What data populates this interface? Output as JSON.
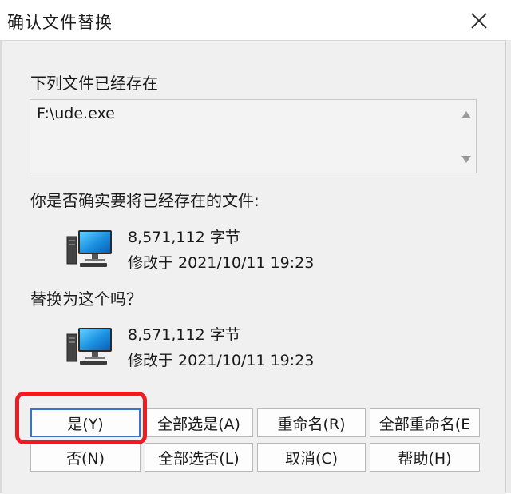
{
  "dialog": {
    "title": "确认文件替换",
    "close_icon": "close-icon"
  },
  "existing": {
    "heading": "下列文件已经存在",
    "path": "F:\\ude.exe"
  },
  "question": "你是否确实要将已经存在的文件:",
  "replace_prompt": "替换为这个吗？",
  "existing_file": {
    "icon": "computer-icon",
    "size": "8,571,112 字节",
    "modified": "修改于 2021/10/11 19:23"
  },
  "new_file": {
    "icon": "computer-icon",
    "size": "8,571,112 字节",
    "modified": "修改于 2021/10/11 19:23"
  },
  "buttons": {
    "yes": "是(Y)",
    "yes_all": "全部选是(A)",
    "rename": "重命名(R)",
    "rename_all": "全部重命名(E",
    "no": "否(N)",
    "no_all": "全部选否(L)",
    "cancel": "取消(C)",
    "help": "帮助(H)"
  },
  "colors": {
    "highlight": "#ee1b23",
    "default_button_border": "#3a74c8",
    "client_background": "#f0f0f0"
  }
}
